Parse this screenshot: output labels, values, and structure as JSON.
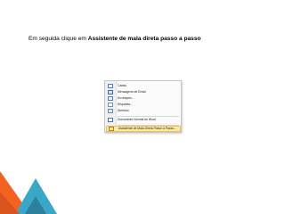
{
  "slide": {
    "instruction_prefix": "Em seguida clique em ",
    "instruction_bold": "Assistente de mala direta passo a passo"
  },
  "menu": {
    "items": [
      {
        "label": "Cartas",
        "icon": "envelope-icon"
      },
      {
        "label": "Mensagens de Email",
        "icon": "email-icon"
      },
      {
        "label": "Envelopes...",
        "icon": "envelope-icon"
      },
      {
        "label": "Etiquetas...",
        "icon": "labels-icon"
      },
      {
        "label": "Diretório",
        "icon": "directory-icon"
      },
      {
        "label": "Documento Normal do Word",
        "icon": "document-icon"
      },
      {
        "label": "Assistente de Mala Direta Passo a Passo...",
        "icon": "wizard-icon",
        "highlighted": true
      }
    ]
  },
  "colors": {
    "orange": "#f26322",
    "teal_dark": "#2e7f9e",
    "teal_light": "#3aa7c9",
    "highlight": "#fde9a4"
  }
}
